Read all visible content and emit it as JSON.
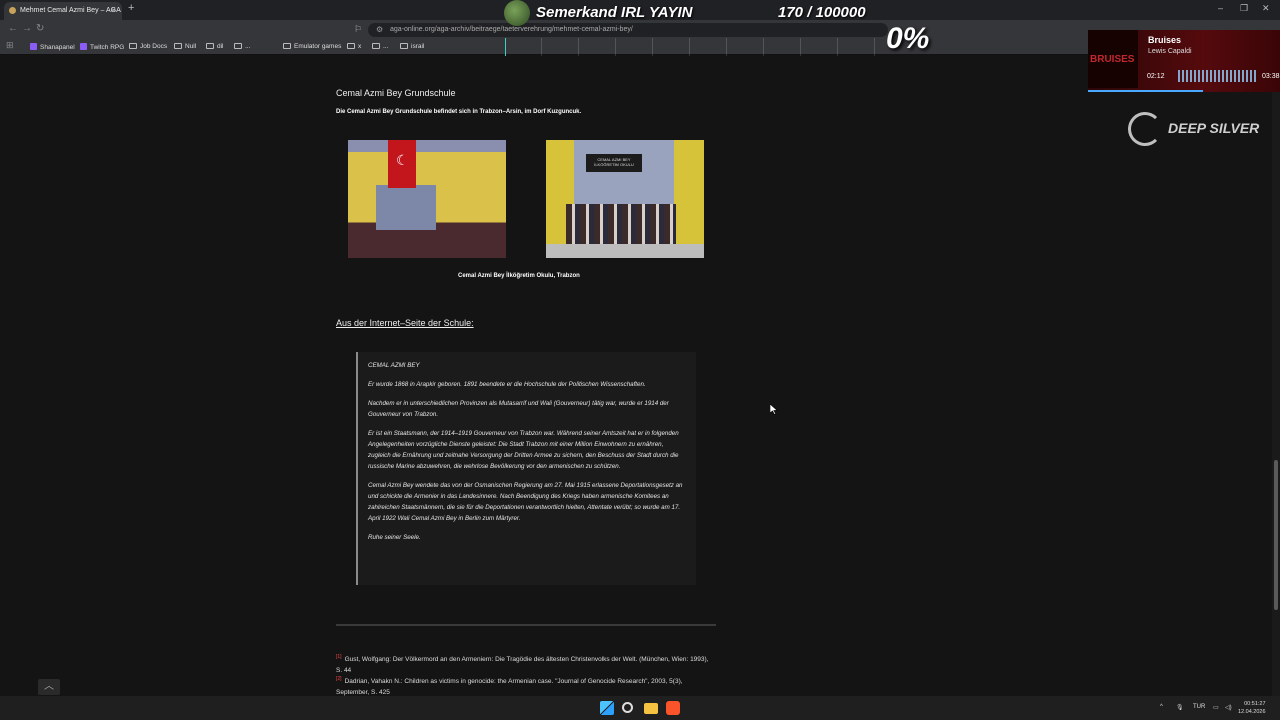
{
  "browser": {
    "tab_title": "Mehmet Cemal Azmi Bey – AGA",
    "url": "aga-online.org/aga-archiv/beitraege/taeterverehrung/mehmet-cemal-azmi-bey/",
    "new_tab": "+",
    "bookmarks": [
      "Shanapanel",
      "Twitch RPG",
      "Job Docs",
      "Null",
      "dil",
      "...",
      "x",
      "...",
      "israil"
    ]
  },
  "overlay": {
    "title": "Semerkand IRL YAYIN",
    "count": "170 / 100000",
    "percent": "0%",
    "progress": 0.0017,
    "music": {
      "album_text": "BRUISES",
      "song": "Bruises",
      "artist": "Lewis Capaldi",
      "time_current": "02:12",
      "time_total": "03:38",
      "progress": 0.6
    },
    "sponsor": "DEEP SILVER"
  },
  "article": {
    "school_heading": "Cemal Azmi Bey Grundschule",
    "school_intro": "Die Cemal Azmi Bey Grundschule befindet sich in Trabzon–Arsin, im Dorf Kuzguncuk.",
    "photo2_sign": "CEMAL AZMI BEY İLKÖĞRETİM OKULU",
    "photo_caption": "Cemal Azmi Bey İlköğretim Okulu, Trabzon",
    "section_heading": "Aus der Internet–Seite der Schule:",
    "quote": [
      "CEMAL AZMI BEY",
      "Er wurde 1868 in Arapkir geboren. 1891 beendete er die Hochschule der Politischen Wissenschaften.",
      "Nachdem er in unterschiedlichen Provinzen als Mutasarrif und Wali (Gouverneur) tätig war, wurde er 1914 der Gouverneur von Trabzon.",
      "Er ist ein Staatsmann, der 1914–1919 Gouverneur von Trabzon war. Während seiner Amtszeit hat er in folgenden Angelegenheiten vorzügliche Dienste geleistet: Die Stadt Trabzon mit einer Million Einwohnern zu ernähren, zugleich die Ernährung und zeitnahe Versorgung der Dritten Armee zu sichern, den Beschuss der Stadt durch die russische Marine abzuwehren, die wehrlose Bevölkerung vor den armenischen zu schützen.",
      "Cemal Azmi Bey wendete das von der Osmanischen Regierung am 27. Mai 1915 erlassene Deportationsgesetz an und schickte die Armenier in das Landesinnere. Nach Beendigung des Kriegs haben armenische Komitees an zahlreichen Staatsmännern, die sie für die Deportationen verantwortlich hielten, Attentate verübt; so wurde am 17. April 1922 Wali Cemal Azmi Bey in Berlin zum Märtyrer.",
      "Ruhe seiner Seele."
    ],
    "footnotes": [
      {
        "num": "[1]",
        "text": "Gust, Wolfgang: Der Völkermord an den Armeniern: Die Tragödie des ältesten Christenvolks der Welt. (München, Wien: 1993), S. 44"
      },
      {
        "num": "[2]",
        "text": "Dadrian, Vahakn N.: Children as victims in genocide: the Armenian case. \"Journal of Genocide Research\", 2003, 5(3), September, S. 425"
      }
    ]
  },
  "taskbar": {
    "lang": "TUR",
    "time": "00:51:27",
    "date": "12.04.2026"
  },
  "colors": {
    "progress_accent": "#3ad3c0",
    "footnote_marker": "#e44444",
    "background": "#141414"
  }
}
